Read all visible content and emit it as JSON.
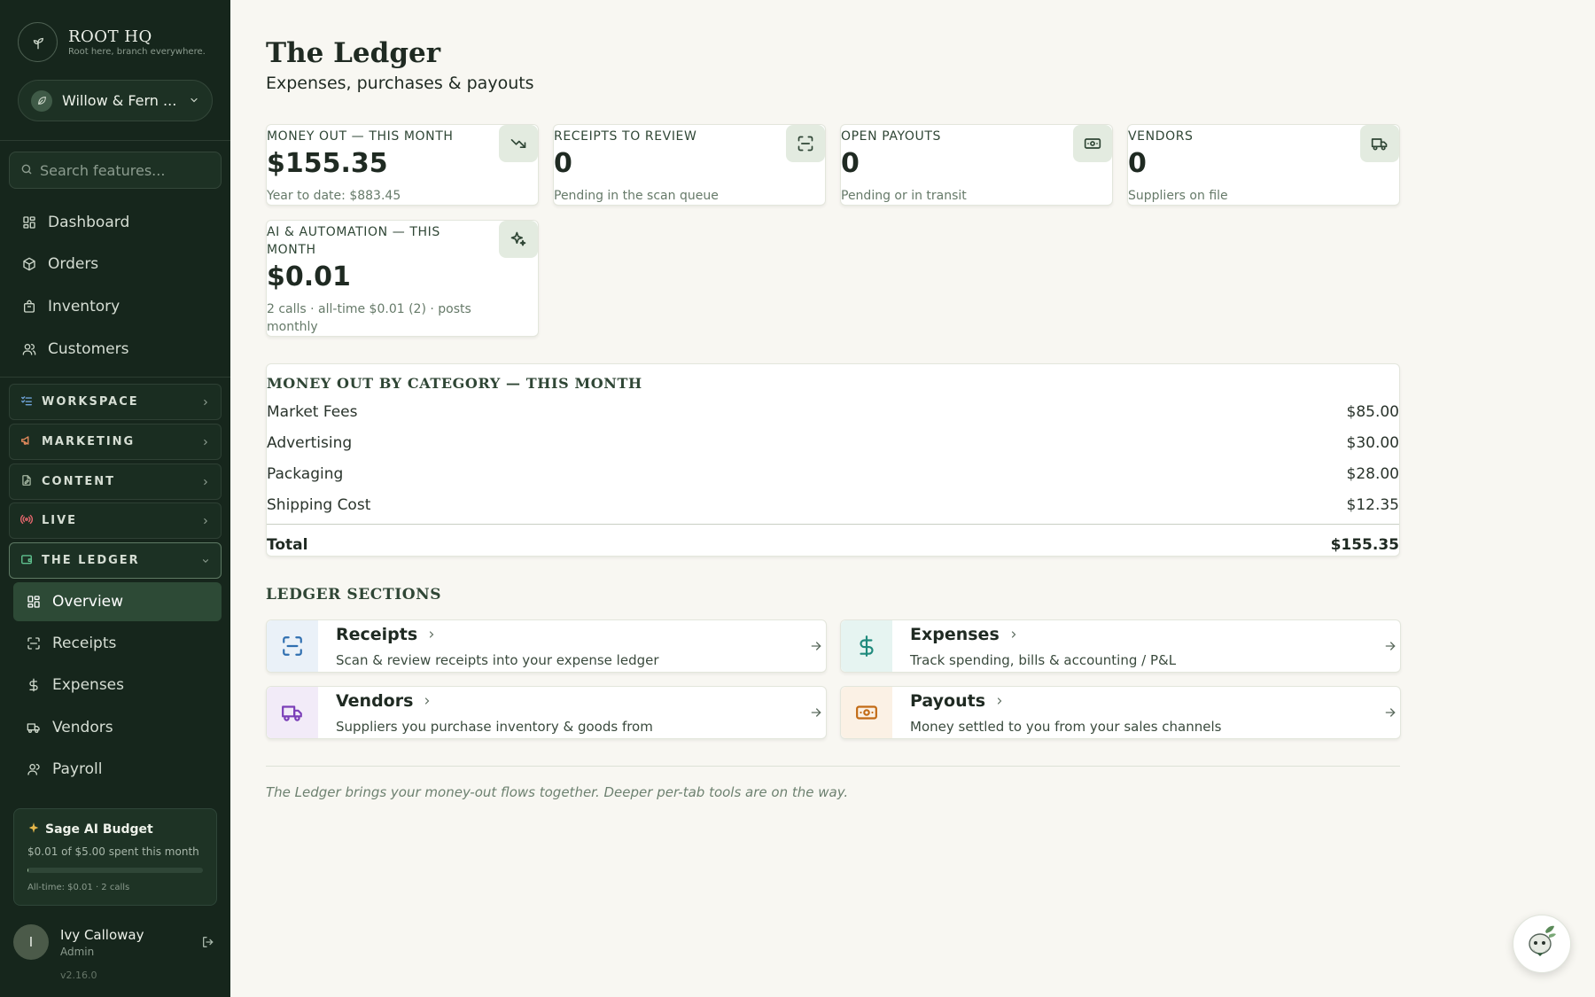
{
  "brand": {
    "title": "ROOT HQ",
    "tagline": "Root here, branch everywhere."
  },
  "shop": {
    "name": "Willow & Fern ..."
  },
  "search": {
    "placeholder": "Search features..."
  },
  "nav": [
    {
      "label": "Dashboard",
      "icon": "grid-icon"
    },
    {
      "label": "Orders",
      "icon": "box-icon"
    },
    {
      "label": "Inventory",
      "icon": "bag-icon"
    },
    {
      "label": "Customers",
      "icon": "users-icon"
    }
  ],
  "groups": [
    {
      "label": "WORKSPACE",
      "icon": "list-check-icon",
      "color": "#6fa3d8"
    },
    {
      "label": "MARKETING",
      "icon": "megaphone-icon",
      "color": "#e28a5c"
    },
    {
      "label": "CONTENT",
      "icon": "document-edit-icon",
      "color": "#a7b8a3"
    },
    {
      "label": "LIVE",
      "icon": "broadcast-icon",
      "color": "#e0656b"
    },
    {
      "label": "THE LEDGER",
      "icon": "wallet-icon",
      "color": "#5fc08e",
      "expanded": true
    }
  ],
  "ledger_items": [
    {
      "label": "Overview",
      "icon": "grid-icon",
      "active": true
    },
    {
      "label": "Receipts",
      "icon": "scan-icon"
    },
    {
      "label": "Expenses",
      "icon": "dollar-icon"
    },
    {
      "label": "Vendors",
      "icon": "truck-icon"
    },
    {
      "label": "Payroll",
      "icon": "user-icon"
    }
  ],
  "budget": {
    "title": "Sage AI Budget",
    "spent": "$0.01 of $5.00 spent this month",
    "progress": 0.002,
    "alltime": "All-time: $0.01 · 2 calls"
  },
  "user": {
    "name": "Ivy Calloway",
    "role": "Admin",
    "initial": "I"
  },
  "version": "v2.16.0",
  "page": {
    "title": "The Ledger",
    "subtitle": "Expenses, purchases & payouts"
  },
  "stats": [
    {
      "label": "MONEY OUT — THIS MONTH",
      "value": "$155.35",
      "note": "Year to date: $883.45",
      "icon": "trending-down-icon"
    },
    {
      "label": "RECEIPTS TO REVIEW",
      "value": "0",
      "note": "Pending in the scan queue",
      "icon": "scan-icon"
    },
    {
      "label": "OPEN PAYOUTS",
      "value": "0",
      "note": "Pending or in transit",
      "icon": "banknote-icon"
    },
    {
      "label": "VENDORS",
      "value": "0",
      "note": "Suppliers on file",
      "icon": "truck-icon"
    },
    {
      "label": "AI & AUTOMATION — THIS MONTH",
      "value": "$0.01",
      "note": "2 calls · all-time $0.01 (2) · posts monthly",
      "icon": "sparkles-icon"
    }
  ],
  "categories": {
    "heading": "MONEY OUT BY CATEGORY — THIS MONTH",
    "rows": [
      {
        "name": "Market Fees",
        "amount": "$85.00"
      },
      {
        "name": "Advertising",
        "amount": "$30.00"
      },
      {
        "name": "Packaging",
        "amount": "$28.00"
      },
      {
        "name": "Shipping Cost",
        "amount": "$12.35"
      }
    ],
    "total_label": "Total",
    "total": "$155.35"
  },
  "sections": {
    "heading": "LEDGER SECTIONS",
    "items": [
      {
        "title": "Receipts",
        "desc": "Scan & review receipts into your expense ledger",
        "icon": "scan-icon",
        "accent": "#2f6fb0",
        "bg": "#eaf1f8"
      },
      {
        "title": "Expenses",
        "desc": "Track spending, bills & accounting / P&L",
        "icon": "dollar-icon",
        "accent": "#1f8a7c",
        "bg": "#e6f4f1"
      },
      {
        "title": "Vendors",
        "desc": "Suppliers you purchase inventory & goods from",
        "icon": "truck-icon",
        "accent": "#7b3fb8",
        "bg": "#f2ebf8"
      },
      {
        "title": "Payouts",
        "desc": "Money settled to you from your sales channels",
        "icon": "banknote-icon",
        "accent": "#c26a14",
        "bg": "#fbf1e5"
      }
    ]
  },
  "footer_note": "The Ledger brings your money-out flows together. Deeper per-tab tools are on the way.",
  "colors": {
    "sidebar_bg": "#16261c",
    "accent_green": "#2d4a36",
    "page_bg": "#f8f7f2"
  }
}
